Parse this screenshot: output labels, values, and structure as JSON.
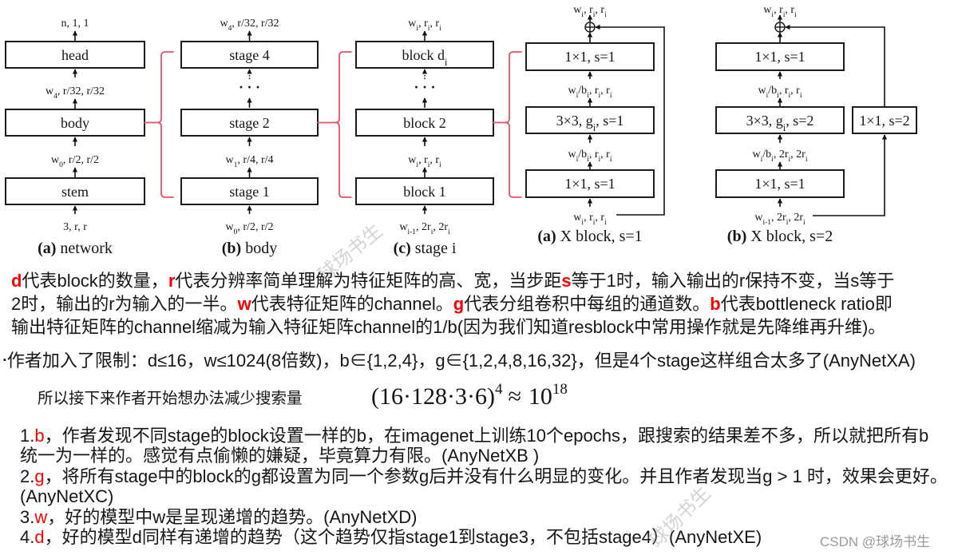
{
  "diagram": {
    "bracket_color": "#e8506b",
    "network": {
      "caption_tag": "(a)",
      "caption_text": "network",
      "boxes": [
        "head",
        "body",
        "stem"
      ],
      "labels": [
        "n, 1, 1",
        "w_{4}, r/32, r/32",
        "w_{0}, r/2, r/2",
        "3, r, r"
      ]
    },
    "body": {
      "caption_tag": "(b)",
      "caption_text": "body",
      "boxes": [
        "stage 4",
        "stage 2",
        "stage 1"
      ],
      "ellipsis": "· · ·",
      "labels": [
        "w_{4}, r/32, r/32",
        "w_{1}, r/4, r/4",
        "w_{0}, r/2, r/2"
      ]
    },
    "stage": {
      "caption_tag": "(c)",
      "caption_text": "stage i",
      "boxes": [
        "block d_{i}",
        "block 2",
        "block 1"
      ],
      "ellipsis": "· · ·",
      "labels": [
        "w_{i}, r_{i}, r_{i}",
        "w_{i}, r_{i}, r_{i}",
        "w_{i-1}, 2r_{i}, 2r_{i}"
      ]
    },
    "xblock_s1": {
      "caption_tag": "(a)",
      "caption_text": "X block, s=1",
      "boxes": [
        "1×1, s=1",
        "3×3, g_{i}, s=1",
        "1×1, s=1"
      ],
      "labels": [
        "w_{i}, r_{i}, r_{i}",
        "w_{i}/b_{i}, r_{i}, r_{i}",
        "w_{i}/b_{i}, r_{i}, r_{i}",
        "w_{i}, r_{i}, r_{i}"
      ]
    },
    "xblock_s2": {
      "caption_tag": "(b)",
      "caption_text": "X block, s=2",
      "boxes": [
        "1×1, s=1",
        "3×3, g_{i}, s=2",
        "1×1, s=1"
      ],
      "shortcut_box": "1×1, s=2",
      "labels": [
        "w_{i}, r_{i}, r_{i}",
        "w_{i}/b_{i}, r_{i}, r_{i}",
        "w_{i}/b_{i}, 2r_{i}, 2r_{i}",
        "w_{i-1}, 2r_{i}, 2r_{i}"
      ]
    }
  },
  "notes": {
    "highlight_color": "#ff0000",
    "definition_lines": [
      [
        {
          "text": "d",
          "highlight": true
        },
        {
          "text": "代表block的数量，",
          "highlight": false
        },
        {
          "text": "r",
          "highlight": true
        },
        {
          "text": "代表分辨率简单理解为特征矩阵的高、宽，当步距",
          "highlight": false
        },
        {
          "text": "s",
          "highlight": true
        },
        {
          "text": "等于1时，输入输出的r保持不变，当s等于",
          "highlight": false
        }
      ],
      [
        {
          "text": "2时，输出的r为输入的一半。",
          "highlight": false
        },
        {
          "text": "w",
          "highlight": true
        },
        {
          "text": "代表特征矩阵的channel。",
          "highlight": false
        },
        {
          "text": "g",
          "highlight": true
        },
        {
          "text": "代表分组卷积中每组的通道数。",
          "highlight": false
        },
        {
          "text": "b",
          "highlight": true
        },
        {
          "text": "代表bottleneck ratio即",
          "highlight": false
        }
      ],
      [
        {
          "text": "输出特征矩阵的channel缩减为输入特征矩阵channel的1/b(因为我们知道resblock中常用操作就是先降维再升维)。",
          "highlight": false
        }
      ]
    ],
    "constraint": {
      "bullet": "▪",
      "text": "作者加入了限制：d≤16，w≤1024(8倍数)，b∈{1,2,4}，g∈{1,2,4,8,16,32}，但是4个stage这样组合太多了(AnyNetXA)"
    },
    "search_space": {
      "text": "所以接下来作者开始想办法减少搜索量",
      "formula": {
        "base": "(16·128·3·6)",
        "exponent": "4",
        "relation": "≈",
        "rhs_base": "10",
        "rhs_exponent": "18"
      }
    },
    "findings": [
      {
        "number": "1.",
        "key": "b",
        "lines": [
          "，作者发现不同stage的block设置一样的b，在imagenet上训练10个epochs，跟搜索的结果差不多，所以就把所有b",
          "统一为一样的。感觉有点偷懒的嫌疑，毕竟算力有限。(AnyNetXB )"
        ]
      },
      {
        "number": "2.",
        "key": "g",
        "lines": [
          "，将所有stage中的block的g都设置为同一个参数g后并没有什么明显的变化。并且作者发现当g > 1 时，效果会更好。",
          "(AnyNetXC)"
        ]
      },
      {
        "number": "3.",
        "key": "w",
        "lines": [
          "，好的模型中w是呈现递增的趋势。(AnyNetXD)"
        ]
      },
      {
        "number": "4.",
        "key": "d",
        "lines": [
          "，好的模型d同样有递增的趋势（这个趋势仅指stage1到stage3，不包括stage4）(AnyNetXE)"
        ]
      }
    ]
  },
  "watermarks": {
    "diagonal": "球场书生",
    "footer": "CSDN @球场书生"
  }
}
